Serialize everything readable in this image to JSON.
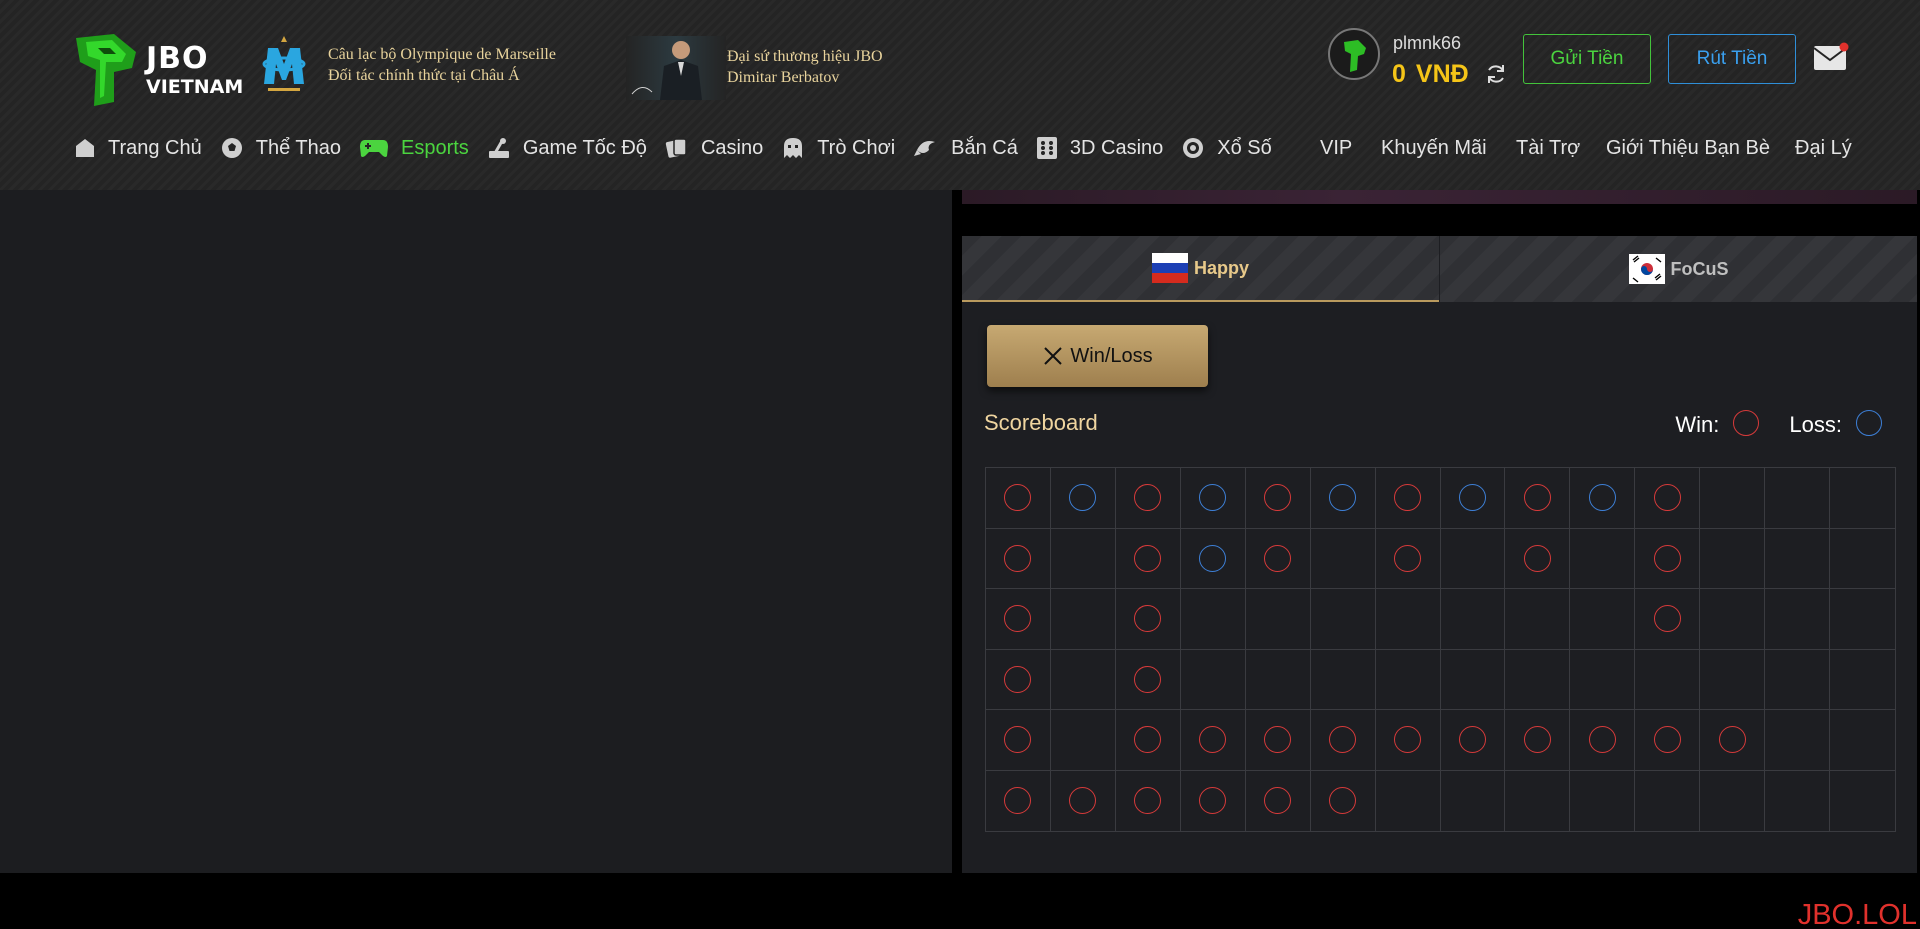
{
  "header": {
    "logo_line1": "JBO",
    "logo_line2": "VIETNAM",
    "partner_line1": "Câu lạc bộ Olympique de Marseille",
    "partner_line2": "Đối tác chính thức tại Châu Á",
    "ambassador_line1": "Đại sứ thương hiệu JBO",
    "ambassador_line2": "Dimitar Berbatov"
  },
  "account": {
    "username": "plmnk66",
    "balance": "0",
    "currency": "VNĐ",
    "deposit_label": "Gửi Tiền",
    "withdraw_label": "Rút Tiền"
  },
  "nav": {
    "items": [
      {
        "label": "Trang Chủ",
        "icon": "home-icon"
      },
      {
        "label": "Thể Thao",
        "icon": "soccer-ball-icon"
      },
      {
        "label": "Esports",
        "icon": "gamepad-icon",
        "active": true
      },
      {
        "label": "Game Tốc Độ",
        "icon": "joystick-icon"
      },
      {
        "label": "Casino",
        "icon": "cards-icon"
      },
      {
        "label": "Trò Chơi",
        "icon": "arcade-icon"
      },
      {
        "label": "Bắn Cá",
        "icon": "fish-icon"
      },
      {
        "label": "3D Casino",
        "icon": "dice-icon"
      },
      {
        "label": "Xổ Số",
        "icon": "lottery-icon"
      }
    ],
    "right_items": [
      "VIP",
      "Khuyến Mãi",
      "Tài Trợ",
      "Giới Thiệu Bạn Bè",
      "Đại Lý"
    ]
  },
  "teams": {
    "team1": {
      "name": "Happy",
      "flag": "russia-flag"
    },
    "team2": {
      "name": "FoCuS",
      "flag": "south-korea-flag"
    }
  },
  "winloss_button": "Win/Loss",
  "scoreboard": {
    "title": "Scoreboard",
    "win_label": "Win:",
    "loss_label": "Loss:",
    "win_color": "#d63a3a",
    "loss_color": "#3d7fd6",
    "columns": [
      [
        "W",
        "W",
        "W",
        "W",
        "W",
        "W"
      ],
      [
        "L",
        "",
        "",
        "",
        "",
        "W"
      ],
      [
        "W",
        "W",
        "W",
        "W",
        "W",
        "W"
      ],
      [
        "L",
        "L",
        "",
        "",
        "W",
        "W"
      ],
      [
        "W",
        "W",
        "",
        "",
        "W",
        "W"
      ],
      [
        "L",
        "",
        "",
        "",
        "W",
        "W"
      ],
      [
        "W",
        "W",
        "",
        "",
        "W",
        ""
      ],
      [
        "L",
        "",
        "",
        "",
        "W",
        ""
      ],
      [
        "W",
        "W",
        "",
        "",
        "W",
        ""
      ],
      [
        "L",
        "",
        "",
        "",
        "W",
        ""
      ],
      [
        "W",
        "W",
        "W",
        "",
        "W",
        ""
      ],
      [
        "",
        "",
        "",
        "",
        "W",
        ""
      ],
      [
        "",
        "",
        "",
        "",
        "",
        ""
      ],
      [
        "",
        "",
        "",
        "",
        "",
        ""
      ]
    ]
  },
  "watermark": "JBO.LOL"
}
